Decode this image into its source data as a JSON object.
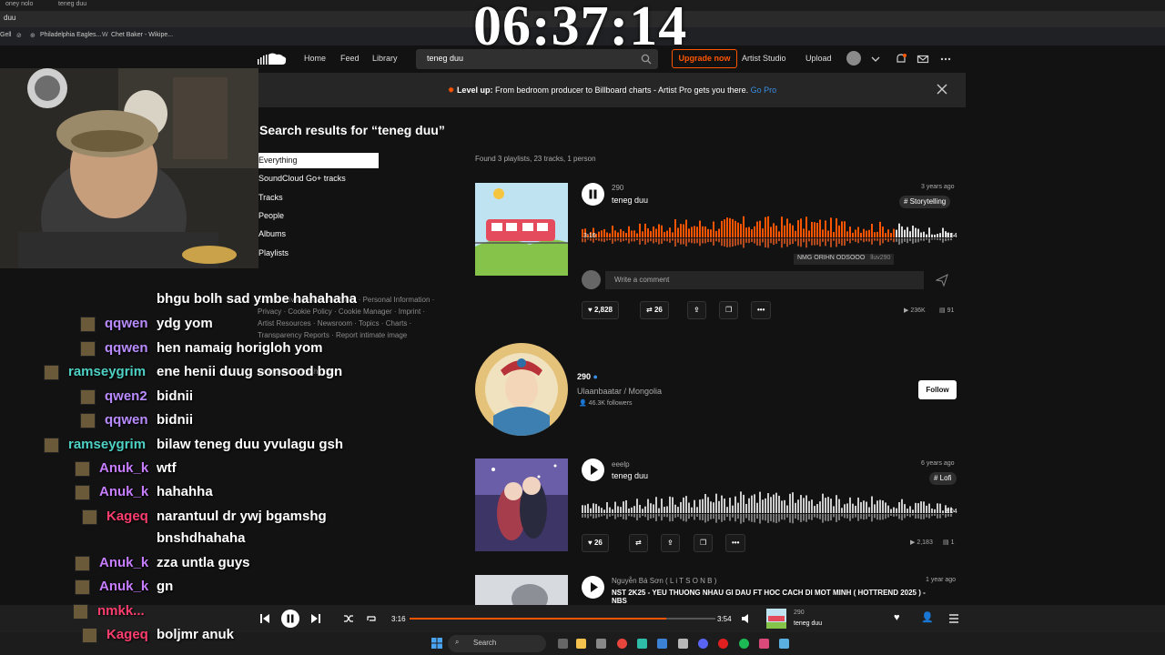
{
  "browser": {
    "tabs": [
      "oney nolo",
      "teneg duu"
    ],
    "address": "duu",
    "bookmarks": [
      "Gell",
      "Philadelphia Eagles...",
      "Chet Baker - Wikipe..."
    ]
  },
  "clock": "06:37:14",
  "header": {
    "nav": [
      "Home",
      "Feed",
      "Library"
    ],
    "search_value": "teneg duu",
    "upgrade_label": "Upgrade now",
    "artist_studio": "Artist Studio",
    "upload": "Upload"
  },
  "banner": {
    "bold": "Level up:",
    "text": "From bedroom producer to Billboard charts - Artist Pro gets you there.",
    "link": "Go Pro"
  },
  "sidebar": {
    "title": "Search results for “teneg duu”",
    "filters": [
      "Everything",
      "SoundCloud Go+ tracks",
      "Tracks",
      "People",
      "Albums",
      "Playlists"
    ],
    "footer_lines": [
      "Legal · Privacy · Cookie Policy · Personal Information ·",
      "Privacy · Cookie Policy · Cookie Manager · Imprint ·",
      "Artist Resources · Newsroom · Topics · Charts ·",
      "Transparency Reports · Report intimate image"
    ],
    "language": "Language: English (US)"
  },
  "results": {
    "found": "Found 3 playlists, 23 tracks, 1 person",
    "track1": {
      "artist": "290",
      "title": "teneg duu",
      "time": "3 years ago",
      "tag": "# Storytelling",
      "elapsed": "3:16",
      "duration": "3:54",
      "played_fraction": 0.84,
      "tooltip": "NMG ORIHN ODSOOO",
      "tooltip_user": "lluv290",
      "comment_placeholder": "Write a comment",
      "likes": "2,828",
      "reposts": "26",
      "plays": "236K",
      "comments": "91"
    },
    "person": {
      "name": "290",
      "location": "Ulaanbaatar / Mongolia",
      "followers": "46.3K followers",
      "follow_label": "Follow"
    },
    "track2": {
      "artist": "eeelp",
      "title": "teneg duu",
      "time": "6 years ago",
      "tag": "# Lofi",
      "duration": "3:04",
      "likes": "26",
      "plays": "2,183",
      "comments": "1"
    },
    "track3": {
      "artist": "Nguyễn Bá Sơn ( L i T S O N B )",
      "title": "NST 2K25 - YEU THUONG NHAU GI DAU FT HOC CACH DI MOT MINH ( HOTTREND 2025 ) - NBS",
      "time": "1 year ago"
    }
  },
  "player": {
    "elapsed": "3:16",
    "duration": "3:54",
    "progress": 0.84,
    "track_artist": "290",
    "track_title": "teneg duu"
  },
  "taskbar": {
    "search": "Search"
  },
  "chat": [
    {
      "user": "",
      "message": "bhgu bolh sad ymbe hahahaha",
      "color": "#ffffff"
    },
    {
      "user": "qqwen",
      "message": "ydg yom",
      "color": "#b88cff"
    },
    {
      "user": "qqwen",
      "message": "hen namaig horigloh yom",
      "color": "#b88cff"
    },
    {
      "user": "ramseygrim",
      "message": "ene henii duug sonsood bgn",
      "color": "#4fd1c5"
    },
    {
      "user": "qwen2",
      "message": "bidnii",
      "color": "#b88cff"
    },
    {
      "user": "qqwen",
      "message": "bidnii",
      "color": "#b88cff"
    },
    {
      "user": "ramseygrim",
      "message": "bilaw teneg duu yvulagu gsh",
      "color": "#4fd1c5"
    },
    {
      "user": "Anuk_k",
      "message": "wtf",
      "color": "#c77dff"
    },
    {
      "user": "Anuk_k",
      "message": "hahahha",
      "color": "#c77dff"
    },
    {
      "user": "Kageq",
      "message": "narantuul dr ywj bgamshg",
      "color": "#ff3d6e"
    },
    {
      "user": "",
      "message": "bnshdhahaha",
      "color": "#ffffff"
    },
    {
      "user": "Anuk_k",
      "message": "zza untla guys",
      "color": "#c77dff"
    },
    {
      "user": "Anuk_k",
      "message": "gn",
      "color": "#c77dff"
    },
    {
      "user": "nmkk...",
      "message": "",
      "color": "#ff3d6e"
    },
    {
      "user": "Kageq",
      "message": "boljmr anuk",
      "color": "#ff3d6e"
    }
  ],
  "colors": {
    "accent": "#ff5500",
    "background": "#121212",
    "link": "#3a8de0"
  }
}
